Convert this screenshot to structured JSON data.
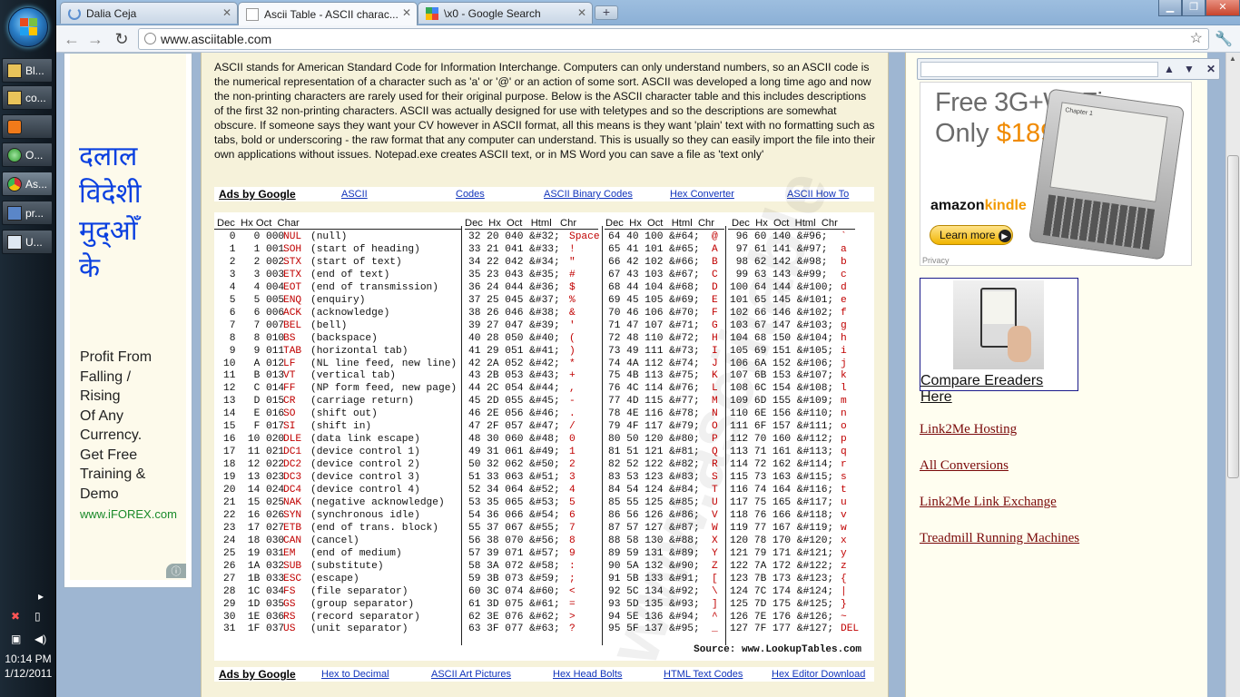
{
  "taskbar": {
    "items": [
      {
        "label": "Bl..."
      },
      {
        "label": "co..."
      },
      {
        "label": ""
      },
      {
        "label": "O..."
      },
      {
        "label": "As..."
      },
      {
        "label": "pr..."
      },
      {
        "label": "U..."
      }
    ],
    "time": "10:14 PM",
    "date": "1/12/2011"
  },
  "browser": {
    "tabs": [
      {
        "title": "Dalia Ceja"
      },
      {
        "title": "Ascii Table - ASCII charac..."
      },
      {
        "title": "\\x0 - Google Search"
      }
    ],
    "url": "www.asciitable.com",
    "new_tab": "+"
  },
  "left_ad": {
    "hindi_lines": [
      "दलाल",
      "विदेशी",
      "मुद्ओँ",
      "के"
    ],
    "text_lines": [
      "Profit From",
      "Falling /",
      "Rising",
      "Of Any",
      "Currency.",
      "Get Free",
      "Training &",
      "Demo"
    ],
    "url": "www.iFOREX.com"
  },
  "intro": "ASCII stands for American Standard Code for Information Interchange. Computers can only understand numbers, so an ASCII code is the numerical representation of a character such as 'a' or '@' or an action of some sort. ASCII was developed a long time ago and now the non-printing characters are rarely used for their original purpose. Below is the ASCII character table and this includes descriptions of the first 32 non-printing characters. ASCII was actually designed for use with teletypes and so the descriptions are somewhat obscure. If someone says they want your CV however in ASCII format, all this means is they want 'plain' text with no formatting such as tabs, bold or underscoring - the raw format that any computer can understand. This is usually so they can easily import the file into their own applications without issues. Notepad.exe creates ASCII text, or in MS Word you can save a file as 'text only'",
  "ads_top": {
    "label": "Ads by Google",
    "links": [
      "ASCII",
      "Codes",
      "ASCII Binary Codes",
      "Hex Converter",
      "ASCII How To"
    ]
  },
  "ads_bottom": {
    "label": "Ads by Google",
    "links": [
      "Hex to Decimal",
      "ASCII Art Pictures",
      "Hex Head Bolts",
      "HTML Text Codes",
      "Hex Editor Download"
    ]
  },
  "table": {
    "header1": "Dec  Hx Oct  Char",
    "header2": "Dec  Hx  Oct   Html   Chr",
    "header3": "Dec  Hx  Oct   Html  Chr",
    "header4": "Dec  Hx  Oct  Html  Chr",
    "col1": [
      [
        " 0",
        " 0",
        "000",
        "NUL",
        "(null)"
      ],
      [
        " 1",
        " 1",
        "001",
        "SOH",
        "(start of heading)"
      ],
      [
        " 2",
        " 2",
        "002",
        "STX",
        "(start of text)"
      ],
      [
        " 3",
        " 3",
        "003",
        "ETX",
        "(end of text)"
      ],
      [
        " 4",
        " 4",
        "004",
        "EOT",
        "(end of transmission)"
      ],
      [
        " 5",
        " 5",
        "005",
        "ENQ",
        "(enquiry)"
      ],
      [
        " 6",
        " 6",
        "006",
        "ACK",
        "(acknowledge)"
      ],
      [
        " 7",
        " 7",
        "007",
        "BEL",
        "(bell)"
      ],
      [
        " 8",
        " 8",
        "010",
        "BS ",
        "(backspace)"
      ],
      [
        " 9",
        " 9",
        "011",
        "TAB",
        "(horizontal tab)"
      ],
      [
        "10",
        " A",
        "012",
        "LF ",
        "(NL line feed, new line)"
      ],
      [
        "11",
        " B",
        "013",
        "VT ",
        "(vertical tab)"
      ],
      [
        "12",
        " C",
        "014",
        "FF ",
        "(NP form feed, new page)"
      ],
      [
        "13",
        " D",
        "015",
        "CR ",
        "(carriage return)"
      ],
      [
        "14",
        " E",
        "016",
        "SO ",
        "(shift out)"
      ],
      [
        "15",
        " F",
        "017",
        "SI ",
        "(shift in)"
      ],
      [
        "16",
        "10",
        "020",
        "DLE",
        "(data link escape)"
      ],
      [
        "17",
        "11",
        "021",
        "DC1",
        "(device control 1)"
      ],
      [
        "18",
        "12",
        "022",
        "DC2",
        "(device control 2)"
      ],
      [
        "19",
        "13",
        "023",
        "DC3",
        "(device control 3)"
      ],
      [
        "20",
        "14",
        "024",
        "DC4",
        "(device control 4)"
      ],
      [
        "21",
        "15",
        "025",
        "NAK",
        "(negative acknowledge)"
      ],
      [
        "22",
        "16",
        "026",
        "SYN",
        "(synchronous idle)"
      ],
      [
        "23",
        "17",
        "027",
        "ETB",
        "(end of trans. block)"
      ],
      [
        "24",
        "18",
        "030",
        "CAN",
        "(cancel)"
      ],
      [
        "25",
        "19",
        "031",
        "EM ",
        "(end of medium)"
      ],
      [
        "26",
        "1A",
        "032",
        "SUB",
        "(substitute)"
      ],
      [
        "27",
        "1B",
        "033",
        "ESC",
        "(escape)"
      ],
      [
        "28",
        "1C",
        "034",
        "FS ",
        "(file separator)"
      ],
      [
        "29",
        "1D",
        "035",
        "GS ",
        "(group separator)"
      ],
      [
        "30",
        "1E",
        "036",
        "RS ",
        "(record separator)"
      ],
      [
        "31",
        "1F",
        "037",
        "US ",
        "(unit separator)"
      ]
    ],
    "col2": [
      [
        "32",
        "20",
        "040",
        "&#32;",
        "Space"
      ],
      [
        "33",
        "21",
        "041",
        "&#33;",
        "!"
      ],
      [
        "34",
        "22",
        "042",
        "&#34;",
        "\""
      ],
      [
        "35",
        "23",
        "043",
        "&#35;",
        "#"
      ],
      [
        "36",
        "24",
        "044",
        "&#36;",
        "$"
      ],
      [
        "37",
        "25",
        "045",
        "&#37;",
        "%"
      ],
      [
        "38",
        "26",
        "046",
        "&#38;",
        "&"
      ],
      [
        "39",
        "27",
        "047",
        "&#39;",
        "'"
      ],
      [
        "40",
        "28",
        "050",
        "&#40;",
        "("
      ],
      [
        "41",
        "29",
        "051",
        "&#41;",
        ")"
      ],
      [
        "42",
        "2A",
        "052",
        "&#42;",
        "*"
      ],
      [
        "43",
        "2B",
        "053",
        "&#43;",
        "+"
      ],
      [
        "44",
        "2C",
        "054",
        "&#44;",
        ","
      ],
      [
        "45",
        "2D",
        "055",
        "&#45;",
        "-"
      ],
      [
        "46",
        "2E",
        "056",
        "&#46;",
        "."
      ],
      [
        "47",
        "2F",
        "057",
        "&#47;",
        "/"
      ],
      [
        "48",
        "30",
        "060",
        "&#48;",
        "0"
      ],
      [
        "49",
        "31",
        "061",
        "&#49;",
        "1"
      ],
      [
        "50",
        "32",
        "062",
        "&#50;",
        "2"
      ],
      [
        "51",
        "33",
        "063",
        "&#51;",
        "3"
      ],
      [
        "52",
        "34",
        "064",
        "&#52;",
        "4"
      ],
      [
        "53",
        "35",
        "065",
        "&#53;",
        "5"
      ],
      [
        "54",
        "36",
        "066",
        "&#54;",
        "6"
      ],
      [
        "55",
        "37",
        "067",
        "&#55;",
        "7"
      ],
      [
        "56",
        "38",
        "070",
        "&#56;",
        "8"
      ],
      [
        "57",
        "39",
        "071",
        "&#57;",
        "9"
      ],
      [
        "58",
        "3A",
        "072",
        "&#58;",
        ":"
      ],
      [
        "59",
        "3B",
        "073",
        "&#59;",
        ";"
      ],
      [
        "60",
        "3C",
        "074",
        "&#60;",
        "<"
      ],
      [
        "61",
        "3D",
        "075",
        "&#61;",
        "="
      ],
      [
        "62",
        "3E",
        "076",
        "&#62;",
        ">"
      ],
      [
        "63",
        "3F",
        "077",
        "&#63;",
        "?"
      ]
    ],
    "col3": [
      [
        "64",
        "40",
        "100",
        "&#64;",
        "@"
      ],
      [
        "65",
        "41",
        "101",
        "&#65;",
        "A"
      ],
      [
        "66",
        "42",
        "102",
        "&#66;",
        "B"
      ],
      [
        "67",
        "43",
        "103",
        "&#67;",
        "C"
      ],
      [
        "68",
        "44",
        "104",
        "&#68;",
        "D"
      ],
      [
        "69",
        "45",
        "105",
        "&#69;",
        "E"
      ],
      [
        "70",
        "46",
        "106",
        "&#70;",
        "F"
      ],
      [
        "71",
        "47",
        "107",
        "&#71;",
        "G"
      ],
      [
        "72",
        "48",
        "110",
        "&#72;",
        "H"
      ],
      [
        "73",
        "49",
        "111",
        "&#73;",
        "I"
      ],
      [
        "74",
        "4A",
        "112",
        "&#74;",
        "J"
      ],
      [
        "75",
        "4B",
        "113",
        "&#75;",
        "K"
      ],
      [
        "76",
        "4C",
        "114",
        "&#76;",
        "L"
      ],
      [
        "77",
        "4D",
        "115",
        "&#77;",
        "M"
      ],
      [
        "78",
        "4E",
        "116",
        "&#78;",
        "N"
      ],
      [
        "79",
        "4F",
        "117",
        "&#79;",
        "O"
      ],
      [
        "80",
        "50",
        "120",
        "&#80;",
        "P"
      ],
      [
        "81",
        "51",
        "121",
        "&#81;",
        "Q"
      ],
      [
        "82",
        "52",
        "122",
        "&#82;",
        "R"
      ],
      [
        "83",
        "53",
        "123",
        "&#83;",
        "S"
      ],
      [
        "84",
        "54",
        "124",
        "&#84;",
        "T"
      ],
      [
        "85",
        "55",
        "125",
        "&#85;",
        "U"
      ],
      [
        "86",
        "56",
        "126",
        "&#86;",
        "V"
      ],
      [
        "87",
        "57",
        "127",
        "&#87;",
        "W"
      ],
      [
        "88",
        "58",
        "130",
        "&#88;",
        "X"
      ],
      [
        "89",
        "59",
        "131",
        "&#89;",
        "Y"
      ],
      [
        "90",
        "5A",
        "132",
        "&#90;",
        "Z"
      ],
      [
        "91",
        "5B",
        "133",
        "&#91;",
        "["
      ],
      [
        "92",
        "5C",
        "134",
        "&#92;",
        "\\"
      ],
      [
        "93",
        "5D",
        "135",
        "&#93;",
        "]"
      ],
      [
        "94",
        "5E",
        "136",
        "&#94;",
        "^"
      ],
      [
        "95",
        "5F",
        "137",
        "&#95;",
        "_"
      ]
    ],
    "col4": [
      [
        " 96",
        "60",
        "140",
        "&#96;",
        "`"
      ],
      [
        " 97",
        "61",
        "141",
        "&#97;",
        "a"
      ],
      [
        " 98",
        "62",
        "142",
        "&#98;",
        "b"
      ],
      [
        " 99",
        "63",
        "143",
        "&#99;",
        "c"
      ],
      [
        "100",
        "64",
        "144",
        "&#100;",
        "d"
      ],
      [
        "101",
        "65",
        "145",
        "&#101;",
        "e"
      ],
      [
        "102",
        "66",
        "146",
        "&#102;",
        "f"
      ],
      [
        "103",
        "67",
        "147",
        "&#103;",
        "g"
      ],
      [
        "104",
        "68",
        "150",
        "&#104;",
        "h"
      ],
      [
        "105",
        "69",
        "151",
        "&#105;",
        "i"
      ],
      [
        "106",
        "6A",
        "152",
        "&#106;",
        "j"
      ],
      [
        "107",
        "6B",
        "153",
        "&#107;",
        "k"
      ],
      [
        "108",
        "6C",
        "154",
        "&#108;",
        "l"
      ],
      [
        "109",
        "6D",
        "155",
        "&#109;",
        "m"
      ],
      [
        "110",
        "6E",
        "156",
        "&#110;",
        "n"
      ],
      [
        "111",
        "6F",
        "157",
        "&#111;",
        "o"
      ],
      [
        "112",
        "70",
        "160",
        "&#112;",
        "p"
      ],
      [
        "113",
        "71",
        "161",
        "&#113;",
        "q"
      ],
      [
        "114",
        "72",
        "162",
        "&#114;",
        "r"
      ],
      [
        "115",
        "73",
        "163",
        "&#115;",
        "s"
      ],
      [
        "116",
        "74",
        "164",
        "&#116;",
        "t"
      ],
      [
        "117",
        "75",
        "165",
        "&#117;",
        "u"
      ],
      [
        "118",
        "76",
        "166",
        "&#118;",
        "v"
      ],
      [
        "119",
        "77",
        "167",
        "&#119;",
        "w"
      ],
      [
        "120",
        "78",
        "170",
        "&#120;",
        "x"
      ],
      [
        "121",
        "79",
        "171",
        "&#121;",
        "y"
      ],
      [
        "122",
        "7A",
        "172",
        "&#122;",
        "z"
      ],
      [
        "123",
        "7B",
        "173",
        "&#123;",
        "{"
      ],
      [
        "124",
        "7C",
        "174",
        "&#124;",
        "|"
      ],
      [
        "125",
        "7D",
        "175",
        "&#125;",
        "}"
      ],
      [
        "126",
        "7E",
        "176",
        "&#126;",
        "~"
      ],
      [
        "127",
        "7F",
        "177",
        "&#127;",
        "DEL"
      ]
    ],
    "source": "Source:  www.LookupTables.com"
  },
  "right": {
    "find_value": "",
    "kindle": {
      "line1": "Free 3G+Wi-Fi",
      "line2": "Only ",
      "price": "$189",
      "brand_a": "amazon",
      "brand_k": "kindle",
      "button": "Learn more",
      "privacy": "Privacy"
    },
    "ereader_link": "Compare Ereaders Here",
    "links": [
      "Link2Me Hosting",
      "All Conversions",
      "Link2Me Link Exchange",
      "Treadmill Running Machines"
    ]
  },
  "colors": {
    "page_bg": "#f6f2da",
    "accent_red": "#c00000",
    "link_blue": "#1033bb",
    "link_maroon": "#7a0a0a"
  }
}
